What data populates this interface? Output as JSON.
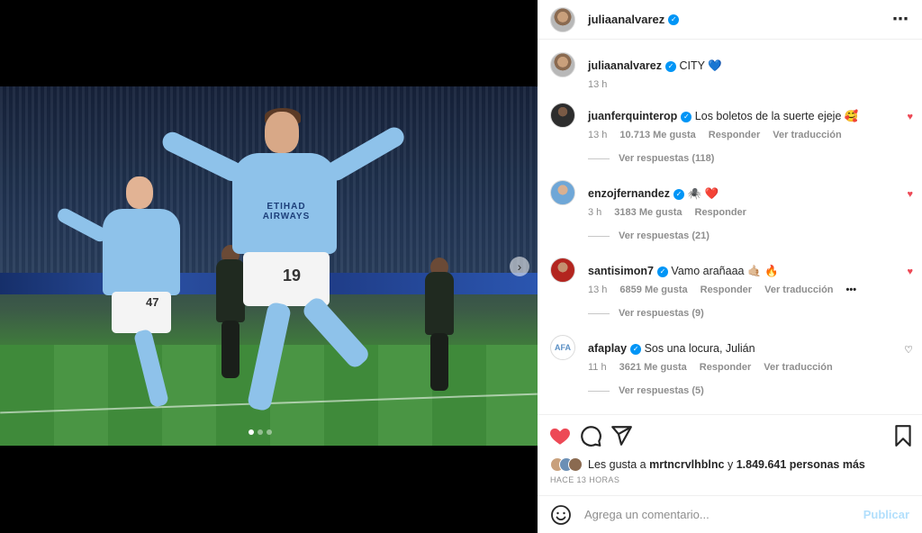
{
  "post": {
    "author": "juliaanalvarez",
    "caption_user": "juliaanalvarez",
    "caption": "CITY",
    "caption_emoji": "💙",
    "caption_time": "13 h",
    "image": {
      "shirt_sponsor": "ETIHAD\nAIRWAYS",
      "main_number": "19",
      "back_number": "47",
      "carousel_dots": 3
    }
  },
  "comments": [
    {
      "user": "juanferquinterop",
      "text": "Los boletos de la suerte ejeje",
      "emoji": "🥰",
      "time": "13 h",
      "likes": "10.713 Me gusta",
      "reply": "Responder",
      "translate": "Ver traducción",
      "replies": "Ver respuestas (118)",
      "liked": true
    },
    {
      "user": "enzojfernandez",
      "text": "",
      "emoji": "🕷️ ❤️",
      "time": "3 h",
      "likes": "3183 Me gusta",
      "reply": "Responder",
      "translate": "",
      "replies": "Ver respuestas (21)",
      "liked": true
    },
    {
      "user": "santisimon7",
      "text": "Vamo arañaaa",
      "emoji": "🤙🏼 🔥",
      "time": "13 h",
      "likes": "6859 Me gusta",
      "reply": "Responder",
      "translate": "Ver traducción",
      "more": "•••",
      "replies": "Ver respuestas (9)",
      "liked": true
    },
    {
      "user": "afaplay",
      "text": "Sos una locura, Julián",
      "emoji": "",
      "time": "11 h",
      "likes": "3621 Me gusta",
      "reply": "Responder",
      "translate": "Ver traducción",
      "replies": "Ver respuestas (5)",
      "liked": false
    }
  ],
  "likes": {
    "prefix": "Les gusta a",
    "user": "mrtncrvlhblnc",
    "connector": "y",
    "count": "1.849.641 personas más"
  },
  "time_ago": "HACE 13 HORAS",
  "add_comment": {
    "placeholder": "Agrega un comentario...",
    "post_label": "Publicar"
  },
  "icons": {
    "like": "heart-filled-icon",
    "comment": "speech-bubble-icon",
    "share": "paper-plane-icon",
    "save": "bookmark-icon",
    "emoji": "smiley-icon",
    "more": "ellipsis-icon",
    "next": "chevron-right-icon"
  },
  "colors": {
    "like_red": "#ed4956",
    "verified_blue": "#0095f6",
    "publish_disabled": "#b2dffc"
  }
}
